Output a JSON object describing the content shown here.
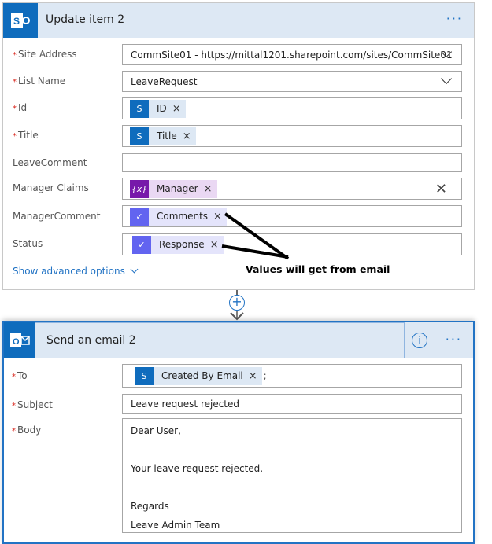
{
  "update_card": {
    "title": "Update item 2",
    "more": "···",
    "fields": [
      {
        "label": "Site Address",
        "required": true,
        "value": "CommSite01 - https://mittal1201.sharepoint.com/sites/CommSite01"
      },
      {
        "label": "List Name",
        "required": true,
        "value": "LeaveRequest"
      },
      {
        "label": "Id",
        "required": true,
        "token": "ID"
      },
      {
        "label": "Title",
        "required": true,
        "token": "Title"
      },
      {
        "label": "LeaveComment",
        "required": false,
        "value": ""
      },
      {
        "label": "Manager Claims",
        "required": false,
        "token": "Manager"
      },
      {
        "label": "ManagerComment",
        "required": false,
        "token": "Comments"
      },
      {
        "label": "Status",
        "required": false,
        "token": "Response"
      }
    ],
    "show_advanced": "Show advanced options"
  },
  "annotation": "Values will get from email",
  "email_card": {
    "title": "Send an email 2",
    "more": "···",
    "to_label": "To",
    "to_token": "Created By Email",
    "to_sep": ";",
    "subject_label": "Subject",
    "subject_value": "Leave request rejected",
    "body_label": "Body",
    "body_lines": [
      "Dear User,",
      "Your leave request rejected.",
      "Regards",
      "Leave Admin Team"
    ]
  },
  "colors": {
    "sharepoint": "#0f6cbd",
    "variable": "#7719aa",
    "approval": "#6264f0",
    "accent": "#2273c4"
  }
}
